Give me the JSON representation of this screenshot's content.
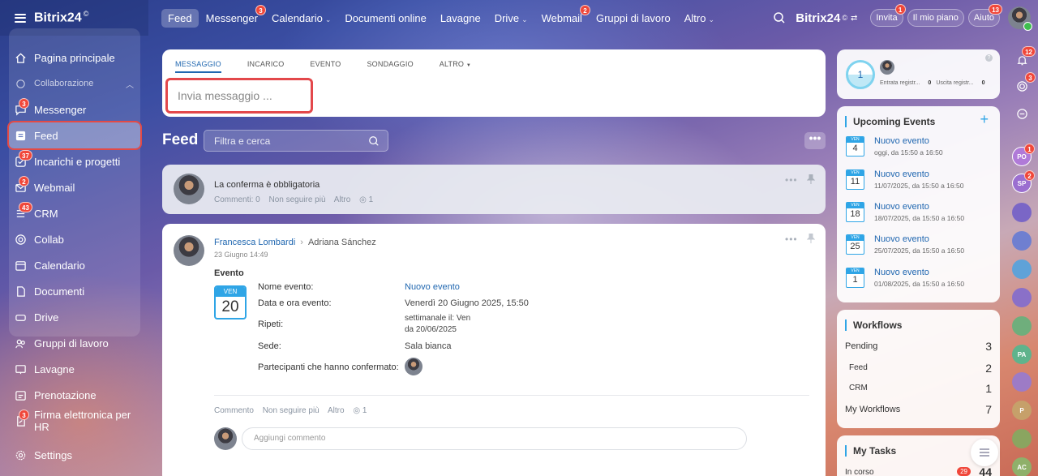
{
  "brand": {
    "name": "Bitrix24",
    "sup": "©"
  },
  "topnav": {
    "items": [
      {
        "label": "Feed",
        "active": true
      },
      {
        "label": "Messenger",
        "badge": "3"
      },
      {
        "label": "Calendario",
        "dropdown": true
      },
      {
        "label": "Documenti online"
      },
      {
        "label": "Lavagne"
      },
      {
        "label": "Drive",
        "dropdown": true
      },
      {
        "label": "Webmail",
        "badge": "2"
      },
      {
        "label": "Gruppi di lavoro"
      },
      {
        "label": "Altro",
        "dropdown": true
      }
    ],
    "invite": {
      "label": "Invita",
      "badge": "1"
    },
    "plan": {
      "label": "Il mio piano"
    },
    "help": {
      "label": "Aiuto",
      "badge": "13"
    }
  },
  "sidebar": {
    "home": "Pagina principale",
    "group_label": "Collaborazione",
    "items": [
      {
        "label": "Messenger",
        "icon": "chat-icon",
        "badge": "3"
      },
      {
        "label": "Feed",
        "icon": "feed-icon",
        "active": true
      },
      {
        "label": "Incarichi e progetti",
        "icon": "tasks-icon",
        "badge": "37"
      },
      {
        "label": "Webmail",
        "icon": "mail-icon",
        "badge": "2"
      },
      {
        "label": "CRM",
        "icon": "crm-icon",
        "badge": "43"
      },
      {
        "label": "Collab",
        "icon": "collab-icon"
      },
      {
        "label": "Calendario",
        "icon": "calendar-icon"
      },
      {
        "label": "Documenti",
        "icon": "document-icon"
      },
      {
        "label": "Drive",
        "icon": "drive-icon"
      },
      {
        "label": "Gruppi di lavoro",
        "icon": "groups-icon"
      },
      {
        "label": "Lavagne",
        "icon": "board-icon"
      }
    ],
    "extra": [
      {
        "label": "Prenotazione",
        "icon": "booking-icon"
      },
      {
        "label": "Firma elettronica per HR",
        "icon": "signature-icon",
        "badge": "3"
      }
    ],
    "settings": "Settings"
  },
  "composer": {
    "tabs": [
      "MESSAGGIO",
      "INCARICO",
      "EVENTO",
      "SONDAGGIO",
      "ALTRO"
    ],
    "placeholder": "Invia messaggio ..."
  },
  "feed": {
    "title": "Feed",
    "search_placeholder": "Filtra e cerca",
    "more": "•••"
  },
  "post1": {
    "title": "La conferma è obbligatoria",
    "comments": "Commenti: 0",
    "unfollow": "Non seguire più",
    "more": "Altro",
    "views": "1"
  },
  "post2": {
    "author": "Francesca Lombardi",
    "recipient": "Adriana Sánchez",
    "date": "23 Giugno 14:49",
    "type_label": "Evento",
    "cal_dow": "VEN",
    "cal_day": "20",
    "fields": {
      "name_k": "Nome evento:",
      "name_v": "Nuovo evento",
      "datetime_k": "Data e ora evento:",
      "datetime_v": "Venerdì 20 Giugno 2025, 15:50",
      "repeat_k": "Ripeti:",
      "repeat_v1": "settimanale il: Ven",
      "repeat_v2": "da 20/06/2025",
      "location_k": "Sede:",
      "location_v": "Sala bianca",
      "participants_k": "Partecipanti che hanno confermato:"
    },
    "comment": "Commento",
    "unfollow": "Non seguire più",
    "more": "Altro",
    "views": "1",
    "add_comment_placeholder": "Aggiungi commento"
  },
  "timeman": {
    "count": "1",
    "in_label": "Entrata registr...",
    "in_value": "0",
    "out_label": "Uscita registr...",
    "out_value": "0"
  },
  "upcoming": {
    "title": "Upcoming Events",
    "events": [
      {
        "dow": "VEN",
        "day": "4",
        "title": "Nuovo evento",
        "time": "oggi, da 15:50 a 16:50"
      },
      {
        "dow": "VEN",
        "day": "11",
        "title": "Nuovo evento",
        "time": "11/07/2025, da 15:50 a 16:50"
      },
      {
        "dow": "VEN",
        "day": "18",
        "title": "Nuovo evento",
        "time": "18/07/2025, da 15:50 a 16:50"
      },
      {
        "dow": "VEN",
        "day": "25",
        "title": "Nuovo evento",
        "time": "25/07/2025, da 15:50 a 16:50"
      },
      {
        "dow": "VEN",
        "day": "1",
        "title": "Nuovo evento",
        "time": "01/08/2025, da 15:50 a 16:50"
      }
    ]
  },
  "workflows": {
    "title": "Workflows",
    "pending_label": "Pending",
    "pending": "3",
    "feed_label": "Feed",
    "feed": "2",
    "crm_label": "CRM",
    "crm": "1",
    "my_label": "My Workflows",
    "my": "7"
  },
  "tasks": {
    "title": "My Tasks",
    "in_progress_label": "In corso",
    "in_progress_badge": "29",
    "in_progress": "44"
  },
  "rail": {
    "bell_badge": "12",
    "spiral_badge": "3",
    "avatars": [
      {
        "initials": "PO",
        "color": "#b07ad8",
        "badge": "1"
      },
      {
        "initials": "SP",
        "color": "#9b6fd0",
        "badge": "2"
      },
      {
        "initials": "",
        "color": "#7a66c6"
      },
      {
        "initials": "",
        "color": "#6f7fd0"
      },
      {
        "initials": "",
        "color": "#5fa2d8"
      },
      {
        "initials": "",
        "color": "#8a70c8"
      },
      {
        "initials": "",
        "color": "#6fae7c"
      },
      {
        "initials": "PA",
        "color": "#5fb38c"
      },
      {
        "initials": "",
        "color": "#9d7bc6"
      },
      {
        "initials": "P",
        "color": "#c6a06a"
      },
      {
        "initials": "",
        "color": "#8aa560"
      },
      {
        "initials": "AC",
        "color": "#8fb06a"
      }
    ]
  }
}
